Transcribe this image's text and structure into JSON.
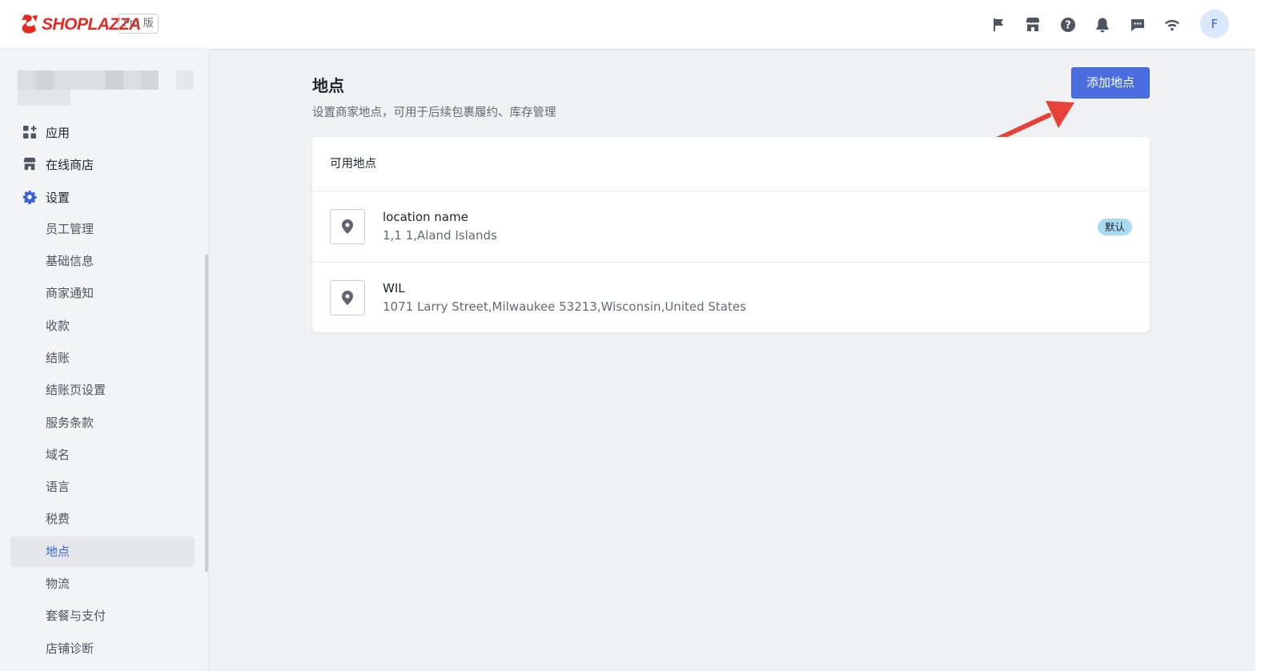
{
  "header": {
    "brand": "SHOPLAZZA",
    "plan_badge": "Pro 版",
    "icons": [
      "flag-icon",
      "store-icon",
      "help-icon",
      "bell-icon",
      "message-icon",
      "wifi-icon"
    ],
    "avatar_initial": "F"
  },
  "sidebar": {
    "main_items": [
      {
        "label": "应用",
        "icon": "apps-icon"
      },
      {
        "label": "在线商店",
        "icon": "store-icon"
      },
      {
        "label": "设置",
        "icon": "gear-icon"
      }
    ],
    "settings_items": [
      {
        "label": "员工管理"
      },
      {
        "label": "基础信息"
      },
      {
        "label": "商家通知"
      },
      {
        "label": "收款"
      },
      {
        "label": "结账"
      },
      {
        "label": "结账页设置"
      },
      {
        "label": "服务条款"
      },
      {
        "label": "域名"
      },
      {
        "label": "语言"
      },
      {
        "label": "税费"
      },
      {
        "label": "地点"
      },
      {
        "label": "物流"
      },
      {
        "label": "套餐与支付"
      },
      {
        "label": "店铺诊断"
      }
    ],
    "selected": "地点"
  },
  "main": {
    "title": "地点",
    "description": "设置商家地点，可用于后续包裹履约、库存管理",
    "add_button": "添加地点",
    "card_title": "可用地点",
    "locations": [
      {
        "name": "location name",
        "address": "1,1 1,Aland Islands",
        "badge": "默认"
      },
      {
        "name": "WIL",
        "address": "1071 Larry Street,Milwaukee 53213,Wisconsin,United States"
      }
    ]
  },
  "colors": {
    "brand_red": "#e62921",
    "primary_blue": "#4a6ee0",
    "selected_text": "#3b63d4",
    "badge_bg": "#a9dbf3",
    "annotation_arrow": "#e8413a"
  }
}
